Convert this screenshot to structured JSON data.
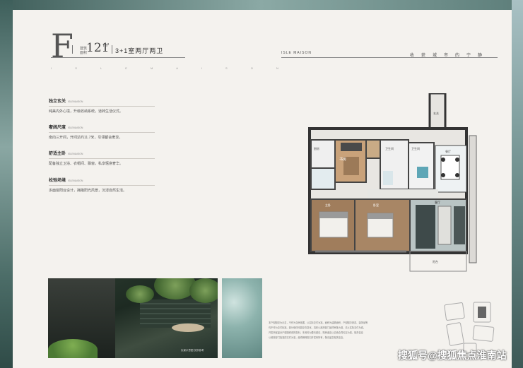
{
  "header": {
    "unit_letter": "F",
    "area_label_top": "建筑",
    "area_label_bottom": "面积",
    "area_value": "121",
    "area_unit": "m²",
    "room_type": "3+1室两厅两卫",
    "dot_letters": "I S L E M A I S O N",
    "brand": "ISLE MAISON",
    "tagline": "收获城市的宁静"
  },
  "features": [
    {
      "title": "独立玄关",
      "en": "ISLEMAISON",
      "desc": "纯美内外心境，升级收纳系统，道转生活仪式。"
    },
    {
      "title": "奢阔尺度",
      "en": "ISLEMAISON",
      "desc": "南向三开间，开间达约11.7米，引领都会奢享。"
    },
    {
      "title": "舒适主卧",
      "en": "ISLEMAISON",
      "desc": "配备独立卫浴、衣帽间、飘窗，私享惬意奢华。"
    },
    {
      "title": "松弛场境",
      "en": "ISLEMAISON",
      "desc": "多面窗阳台设计，拥抱阳光风景，沉浸自然生活。"
    }
  ],
  "photo": {
    "caption": "实景示意图 仅供参考"
  },
  "floorplan": {
    "rooms": {
      "study": "书房",
      "kitchen": "厨房",
      "bath1": "卫生间",
      "bath2": "卫生间",
      "dining": "餐厅",
      "living": "客厅",
      "master": "主卧",
      "bedroom": "卧室",
      "balcony": "阳台",
      "entry": "玄关"
    }
  },
  "description": {
    "lines": [
      "本户型图仅为示意，不作为交房依据，以实际交付为准。面积为建筑面积，户型图中家具、装饰品等",
      "均不作为交付标准。部分墙体可能存在变化，具体以政府部门最终审批为准，请以实际交付为准。",
      "开发商保留对户型图修改的权利，本资料为要约邀请，购房者应以买卖合同约定为准，相关信息",
      "以政府部门批准的文件为准，最终解释权归开发商所有，敬请留意相关信息。"
    ]
  },
  "watermark": "搜狐号@搜狐焦点淮南站",
  "colors": {
    "page_bg": "#f4f2ee",
    "frame": "#6f8a86",
    "text_dark": "#333333"
  }
}
